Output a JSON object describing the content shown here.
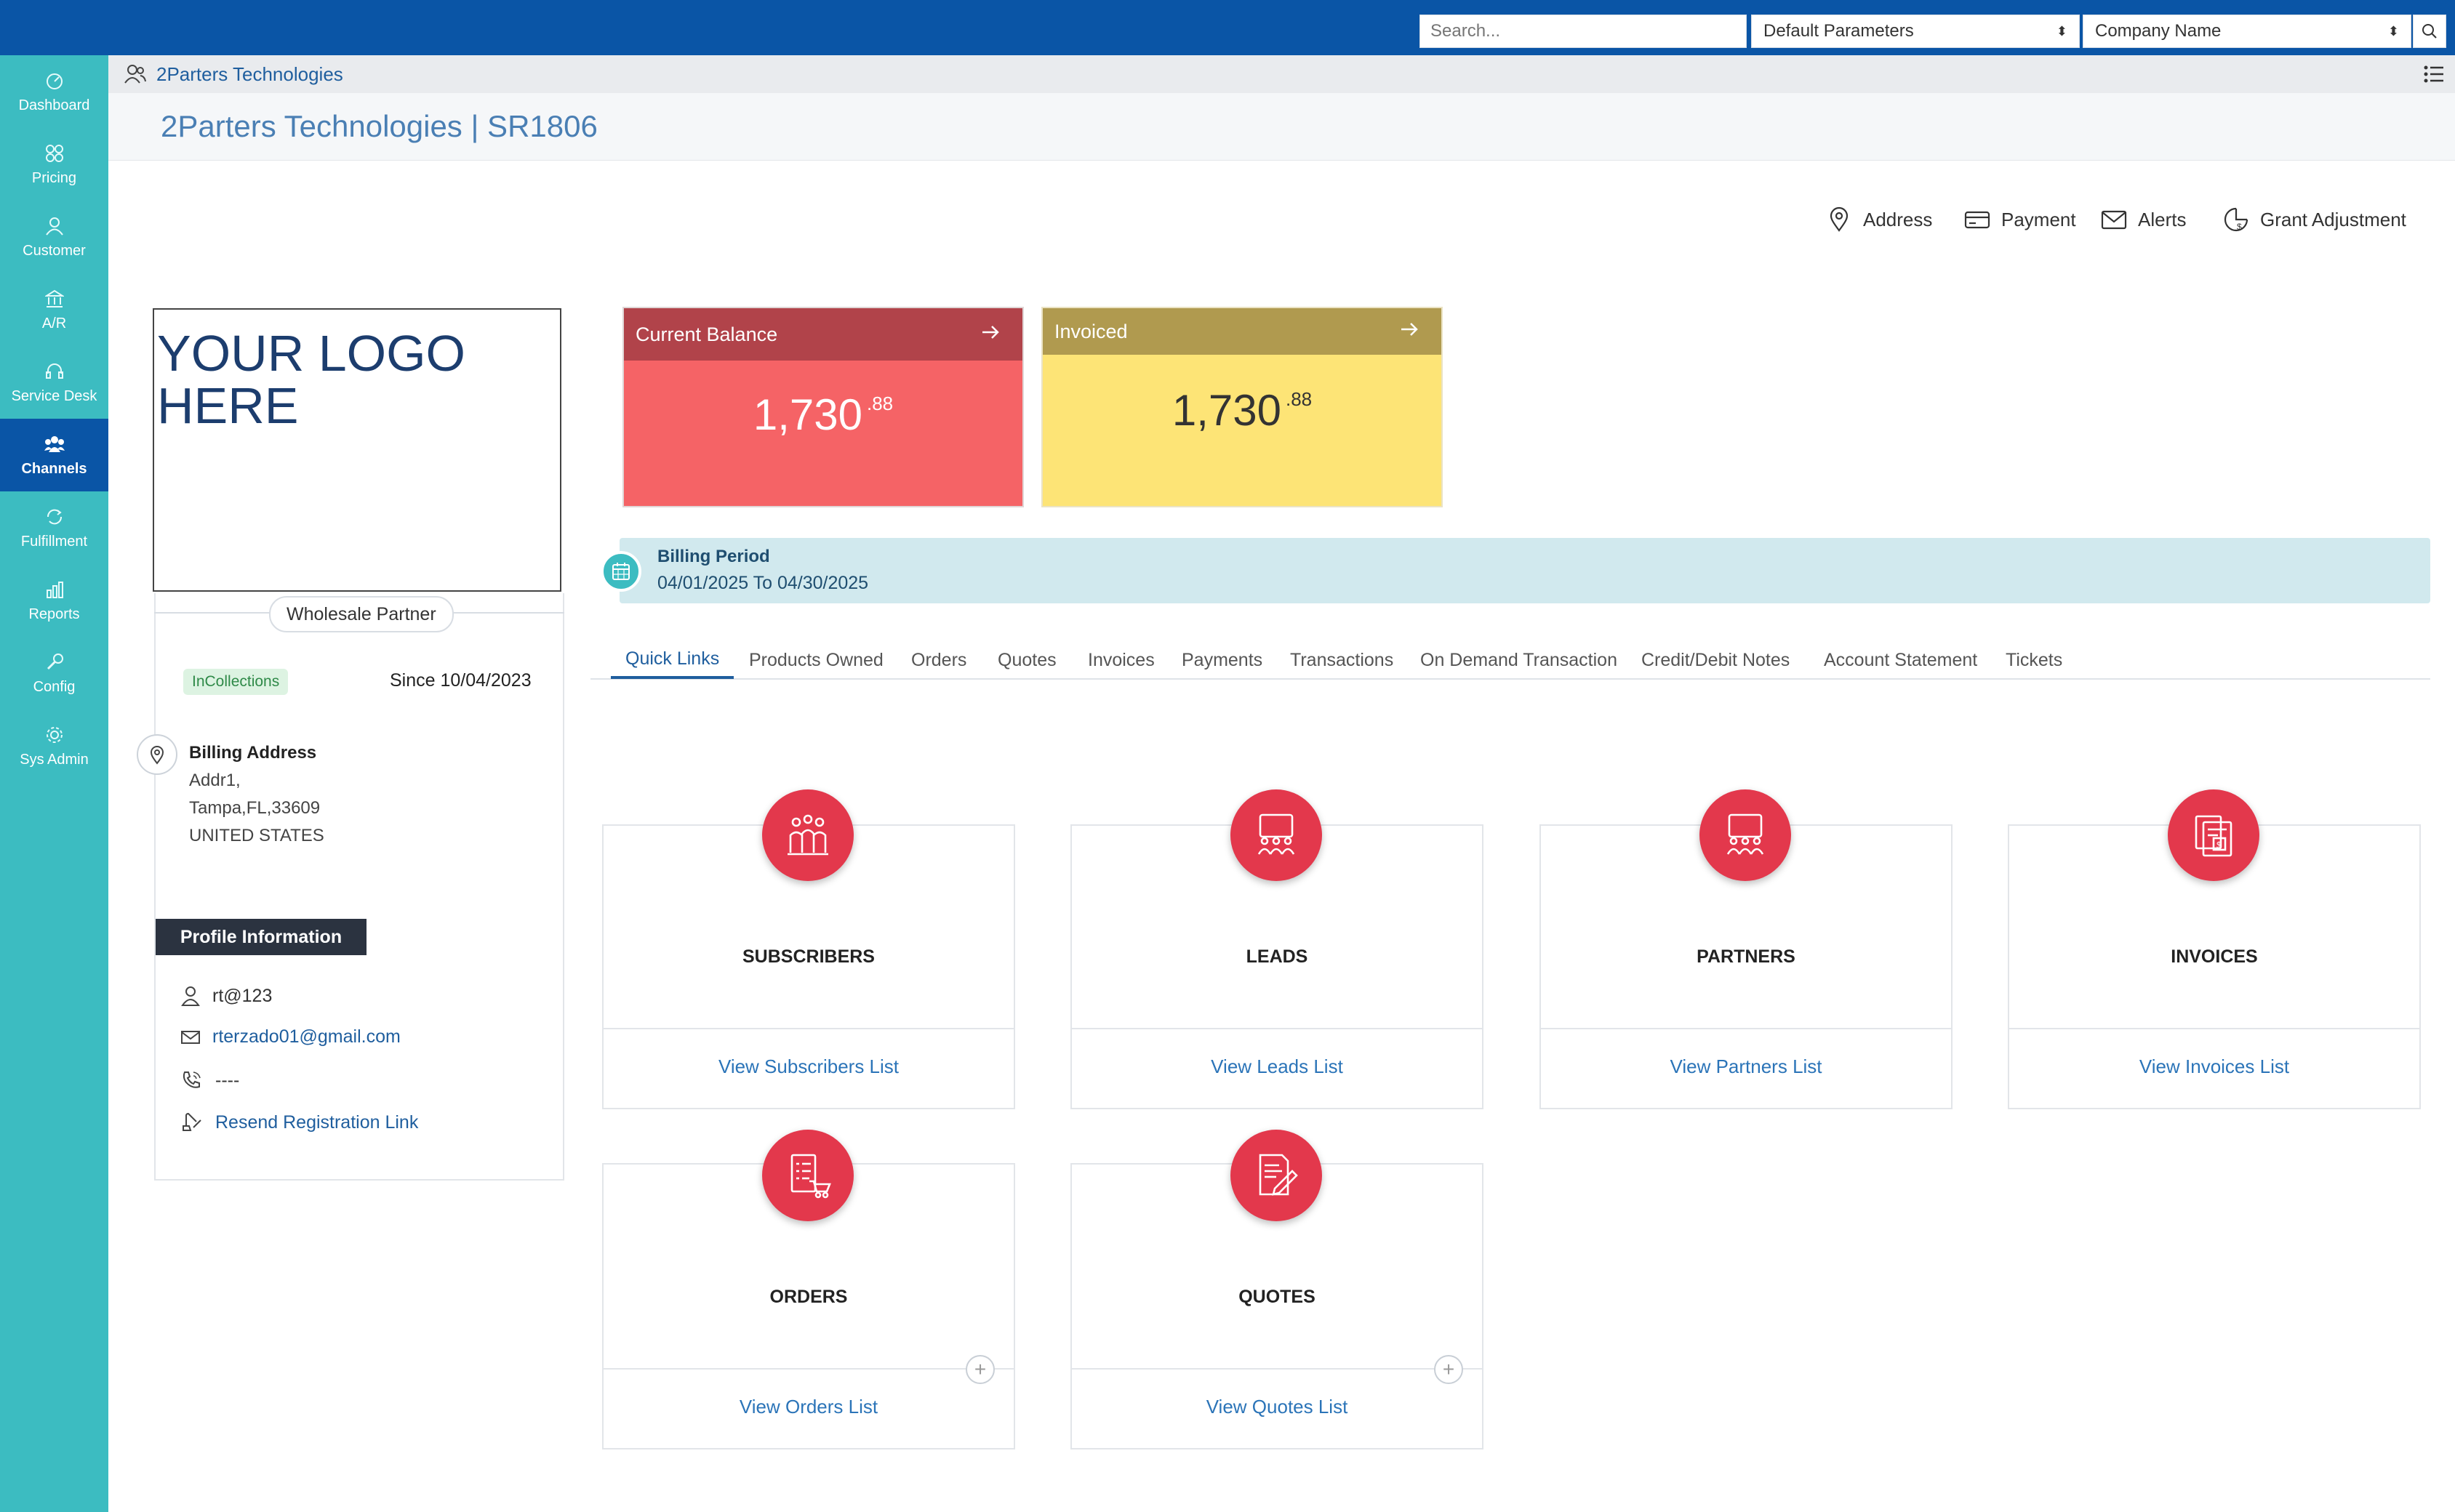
{
  "topbar": {
    "search_placeholder": "Search...",
    "params_select": "Default Parameters",
    "company_select": "Company Name"
  },
  "sidebar": {
    "items": [
      {
        "label": "Dashboard",
        "icon": "dashboard-icon"
      },
      {
        "label": "Pricing",
        "icon": "pricing-icon"
      },
      {
        "label": "Customer",
        "icon": "customer-icon"
      },
      {
        "label": "A/R",
        "icon": "bank-icon"
      },
      {
        "label": "Service Desk",
        "icon": "headset-icon"
      },
      {
        "label": "Channels",
        "icon": "channels-icon",
        "active": true
      },
      {
        "label": "Fulfillment",
        "icon": "fulfillment-icon"
      },
      {
        "label": "Reports",
        "icon": "reports-icon"
      },
      {
        "label": "Config",
        "icon": "wrench-icon"
      },
      {
        "label": "Sys Admin",
        "icon": "gear-icon"
      }
    ]
  },
  "breadcrumb": {
    "text": "2Parters Technologies"
  },
  "page_title": "2Parters Technologies | SR1806",
  "actions": {
    "address": "Address",
    "payment": "Payment",
    "alerts": "Alerts",
    "grant": "Grant Adjustment"
  },
  "profile": {
    "logo_text_line1": "YOUR LOGO",
    "logo_text_line2": "HERE",
    "partner_type": "Wholesale Partner",
    "status": "InCollections",
    "since": "Since 10/04/2023",
    "billing_heading": "Billing Address",
    "address_lines": [
      "Addr1,",
      "Tampa,FL,33609",
      "UNITED STATES"
    ],
    "info_heading": "Profile Information",
    "username": "rt@123",
    "email": "rterzado01@gmail.com",
    "phone": "----",
    "resend_link": "Resend Registration Link"
  },
  "balance": {
    "label": "Current Balance",
    "whole": "1,730",
    "cents": ".88"
  },
  "invoiced": {
    "label": "Invoiced",
    "whole": "1,730",
    "cents": ".88"
  },
  "billing_period": {
    "label": "Billing Period",
    "range": "04/01/2025 To 04/30/2025"
  },
  "tabs": [
    "Quick Links",
    "Products Owned",
    "Orders",
    "Quotes",
    "Invoices",
    "Payments",
    "Transactions",
    "On Demand Transaction",
    "Credit/Debit Notes",
    "Account Statement",
    "Tickets"
  ],
  "quick_links": [
    {
      "title": "SUBSCRIBERS",
      "link": "View Subscribers List",
      "icon": "subscribers-icon"
    },
    {
      "title": "LEADS",
      "link": "View Leads List",
      "icon": "leads-icon"
    },
    {
      "title": "PARTNERS",
      "link": "View Partners List",
      "icon": "partners-icon"
    },
    {
      "title": "INVOICES",
      "link": "View Invoices List",
      "icon": "invoices-icon"
    },
    {
      "title": "ORDERS",
      "link": "View Orders List",
      "icon": "orders-icon"
    },
    {
      "title": "QUOTES",
      "link": "View Quotes List",
      "icon": "quotes-icon"
    }
  ],
  "colors": {
    "topbar": "#0a55a6",
    "sidebar": "#3cbcc1",
    "balance_card": "#f56366",
    "balance_header": "#b1434a",
    "invoiced_card": "#fde476",
    "invoiced_header": "#b09a4f",
    "quick_link_icon": "#e3384c",
    "status_badge": "#2f8a48"
  }
}
